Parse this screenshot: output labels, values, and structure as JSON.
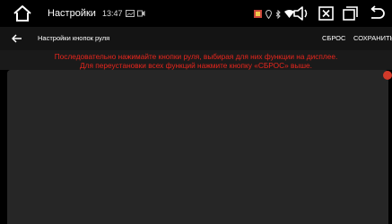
{
  "statusbar": {
    "title": "Настройки",
    "time": "13:47"
  },
  "toolbar": {
    "title": "Настройки кнопок руля",
    "reset_label": "СБРОС",
    "save_label": "СОХРАНИТЬ"
  },
  "message": {
    "line1": "Последовательно нажимайте кнопки руля, выбирая для них функции на дисплее.",
    "line2": "Для переустановки всех функций нажмите кнопку «СБРОС» выше."
  },
  "colors": {
    "message": "#e8261d",
    "panel": "#262626",
    "background": "#000000"
  },
  "icons": {
    "home": "home-icon",
    "back": "back-arrow-icon",
    "volume": "volume-icon",
    "close_app": "close-app-icon",
    "recent_apps": "recent-apps-icon",
    "return": "return-icon"
  }
}
